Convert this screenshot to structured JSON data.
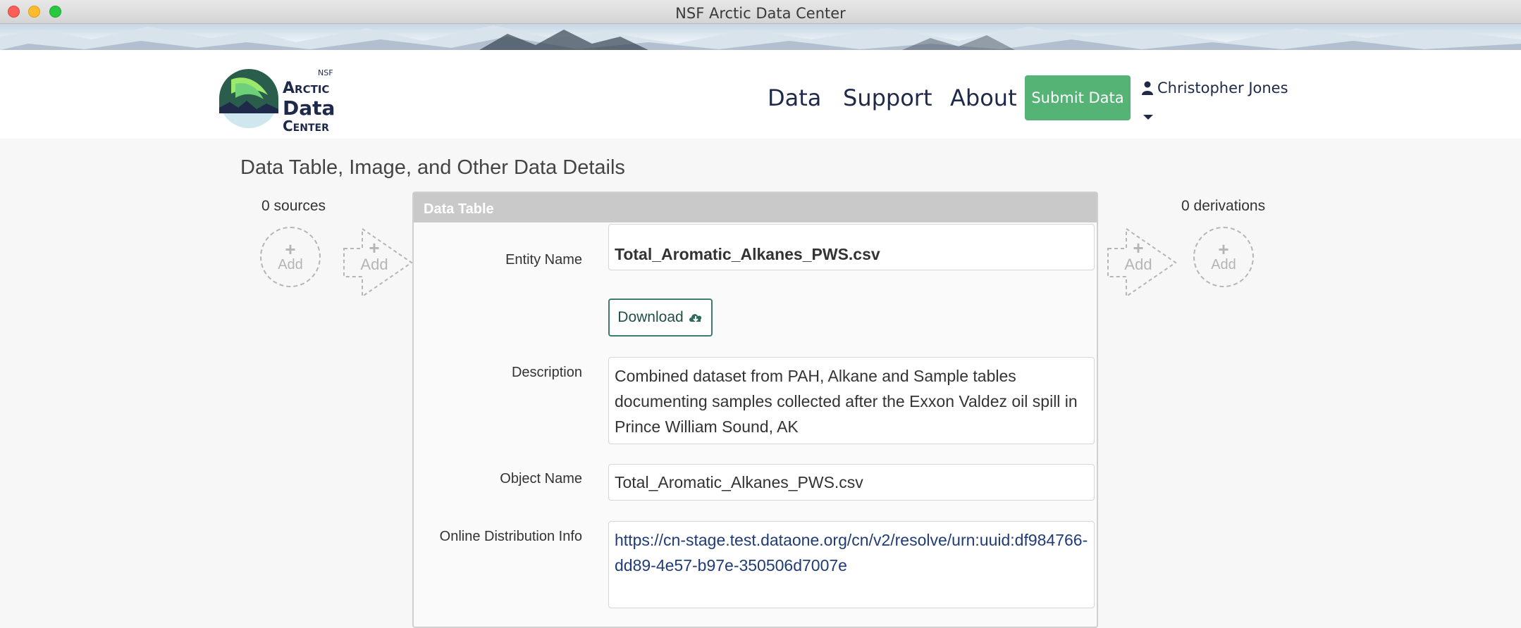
{
  "window": {
    "title": "NSF Arctic Data Center"
  },
  "logo": {
    "nsf": "NSF",
    "line1": "Arctic",
    "line2": "Data",
    "line3": "Center"
  },
  "nav": {
    "items": [
      {
        "label": "Data"
      },
      {
        "label": "Support"
      },
      {
        "label": "About"
      }
    ],
    "submit_label": "Submit Data",
    "user_name": "Christopher Jones"
  },
  "page": {
    "title": "Data Table, Image, and Other Data Details"
  },
  "provenance": {
    "sources_label": "0 sources",
    "derivations_label": "0 derivations",
    "add_label": "Add",
    "plus": "+"
  },
  "panel": {
    "header": "Data Table",
    "entity_name_label": "Entity Name",
    "entity_name": "Total_Aromatic_Alkanes_PWS.csv",
    "download_label": "Download",
    "description_label": "Description",
    "description": "Combined dataset from PAH, Alkane and Sample tables documenting samples collected after the Exxon Valdez oil spill in Prince William Sound, AK",
    "object_name_label": "Object Name",
    "object_name": "Total_Aromatic_Alkanes_PWS.csv",
    "online_dist_label": "Online Distribution Info",
    "online_dist_url": "https://cn-stage.test.dataone.org/cn/v2/resolve/urn:uuid:df984766-dd89-4e57-b97e-350506d7007e"
  },
  "colors": {
    "brand_navy": "#1f2a4a",
    "submit_green": "#55b475",
    "panel_header": "#c9c9c9",
    "link": "#1f3b78"
  }
}
